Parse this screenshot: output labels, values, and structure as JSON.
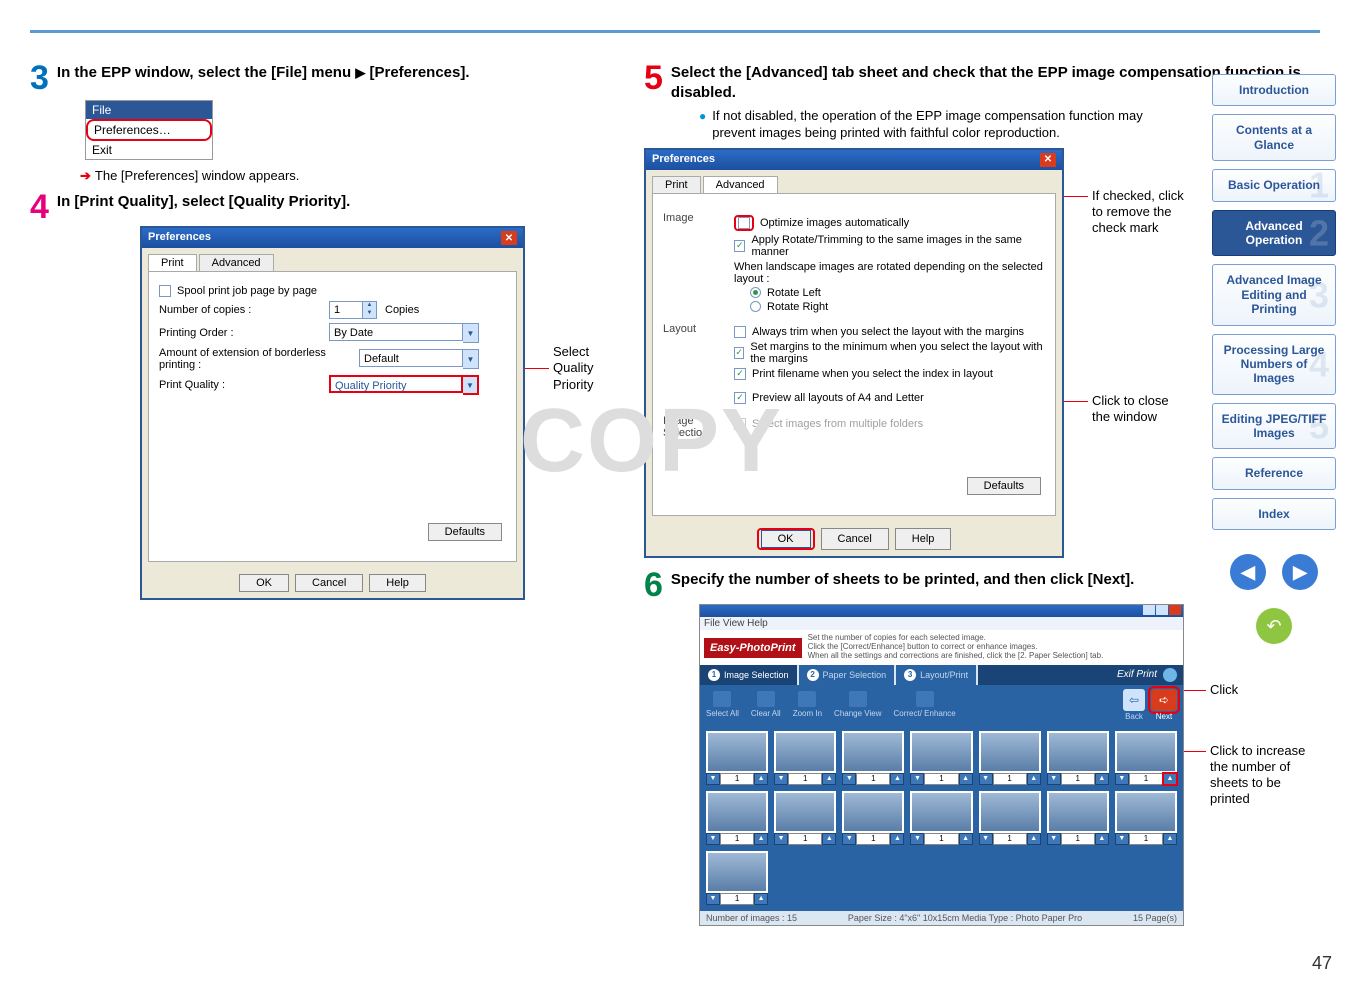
{
  "page_number": "47",
  "watermark": "COPY",
  "sidenav": {
    "intro": "Introduction",
    "contents": "Contents at a Glance",
    "basic": "Basic Operation",
    "advop": "Advanced Operation",
    "advimg": "Advanced Image Editing and Printing",
    "proc": "Processing Large Numbers of Images",
    "edit": "Editing JPEG/TIFF Images",
    "ref": "Reference",
    "index": "Index",
    "wm1": "1",
    "wm2": "2",
    "wm3": "3",
    "wm4": "4",
    "wm5": "5"
  },
  "step3": {
    "num": "3",
    "text_a": "In the EPP window, select the [File] menu ",
    "text_b": " [Preferences].",
    "menu": {
      "file": "File",
      "prefs": "Preferences…",
      "exit": "Exit"
    },
    "result": "The [Preferences] window appears."
  },
  "step4": {
    "num": "4",
    "text": "In [Print Quality], select [Quality Priority].",
    "dlg": {
      "title": "Preferences",
      "tab_print": "Print",
      "tab_adv": "Advanced",
      "spool": "Spool print job page by page",
      "copies_lbl": "Number of copies :",
      "copies_val": "1",
      "copies_unit": "Copies",
      "order_lbl": "Printing Order :",
      "order_val": "By Date",
      "ext_lbl": "Amount of extension of borderless printing :",
      "ext_val": "Default",
      "pq_lbl": "Print Quality :",
      "pq_val": "Quality Priority",
      "defaults": "Defaults",
      "ok": "OK",
      "cancel": "Cancel",
      "help": "Help"
    },
    "anno": "Select Quality Priority"
  },
  "step5": {
    "num": "5",
    "text": "Select the [Advanced] tab sheet and check that the EPP image compensation function is disabled.",
    "bullet": "If not disabled, the operation of the EPP image compensation function may prevent images being printed with faithful color reproduction.",
    "dlg": {
      "title": "Preferences",
      "tab_print": "Print",
      "tab_adv": "Advanced",
      "sec_image": "Image",
      "opt_optimize": "Optimize images automatically",
      "opt_apply": "Apply Rotate/Trimming to the same images in the same manner",
      "opt_landscape": "When landscape images are rotated depending on the selected layout :",
      "opt_rotleft": "Rotate Left",
      "opt_rotright": "Rotate Right",
      "sec_layout": "Layout",
      "opt_trim": "Always trim when you select the layout with the margins",
      "opt_setmargins": "Set margins to the minimum when you select the layout with the margins",
      "opt_printfilename": "Print filename when you select the index in layout",
      "opt_preview": "Preview all layouts of A4 and Letter",
      "sec_imgsel": "Image Selection",
      "opt_multifolder": "Select images from multiple folders",
      "defaults": "Defaults",
      "ok": "OK",
      "cancel": "Cancel",
      "help": "Help"
    },
    "anno_check": "If checked, click to remove the check mark",
    "anno_close": "Click to close the window"
  },
  "step6": {
    "num": "6",
    "text": "Specify the number of sheets to be printed, and then click [Next].",
    "epp": {
      "appname": "Easy-PhotoPrint",
      "menubar": "File  View  Help",
      "desc1": "Set the number of copies for each selected image.",
      "desc2": "Click the [Correct/Enhance] button to correct or enhance images.",
      "desc3": "When all the settings and corrections are finished, click the [2. Paper Selection] tab.",
      "step1": "Image Selection",
      "step2": "Paper Selection",
      "step3": "Layout/Print",
      "exifprint": "Exif Print",
      "tool_selectall": "Select All",
      "tool_clearall": "Clear All",
      "tool_zoomin": "Zoom In",
      "tool_change": "Change View",
      "tool_correct": "Correct/ Enhance",
      "back": "Back",
      "next": "Next",
      "status_left": "Number of images : 15",
      "status_mid": "Paper Size : 4\"x6\"  10x15cm  Media Type : Photo Paper Pro",
      "status_right": "15 Page(s)"
    },
    "anno_click": "Click",
    "anno_increase": "Click to increase the number of sheets to be printed"
  }
}
